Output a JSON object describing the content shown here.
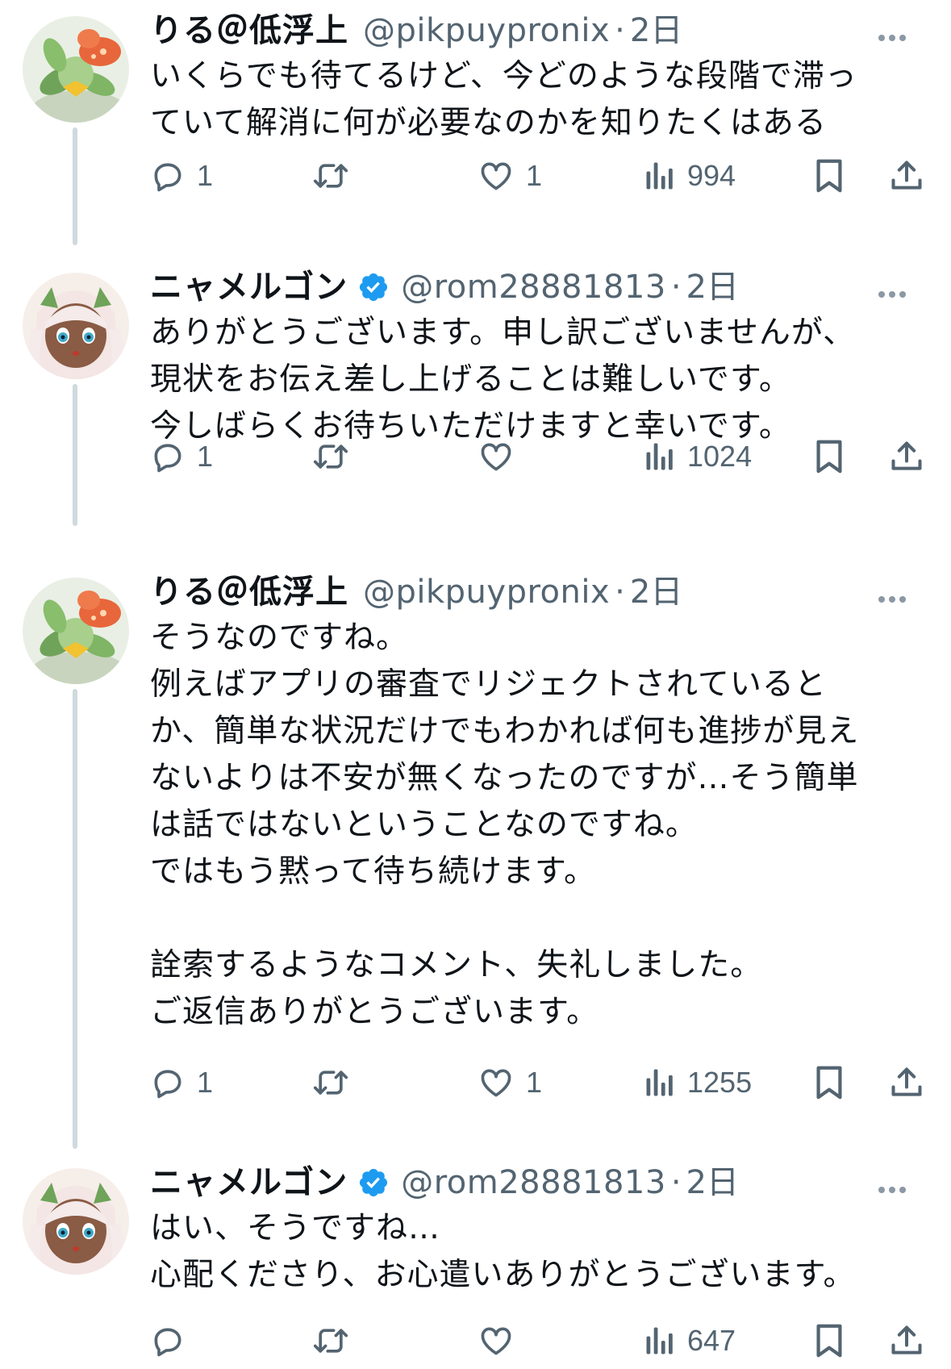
{
  "tweets": [
    {
      "display_name": "りる＠低浮上",
      "verified": false,
      "handle": "@pikpuypronix",
      "separator": "·",
      "time": "2日",
      "text": "いくらでも待てるけど、今どのような段階で滞っ\nていて解消に何が必要なのかを知りたくはある",
      "replies": "1",
      "retweets": "",
      "likes": "1",
      "views": "994"
    },
    {
      "display_name": "ニャメルゴン",
      "verified": true,
      "handle": "@rom28881813",
      "separator": "·",
      "time": "2日",
      "text": "ありがとうございます。申し訳ございませんが、\n現状をお伝え差し上げることは難しいです。\n今しばらくお待ちいただけますと幸いです。",
      "replies": "1",
      "retweets": "",
      "likes": "",
      "views": "1024"
    },
    {
      "display_name": "りる＠低浮上",
      "verified": false,
      "handle": "@pikpuypronix",
      "separator": "·",
      "time": "2日",
      "text": "そうなのですね。\n例えばアプリの審査でリジェクトされていると\nか、簡単な状況だけでもわかれば何も進捗が見え\nないよりは不安が無くなったのですが…そう簡単\nは話ではないということなのですね。\nではもう黙って待ち続けます。\n\n詮索するようなコメント、失礼しました。\nご返信ありがとうございます。",
      "replies": "1",
      "retweets": "",
      "likes": "1",
      "views": "1255"
    },
    {
      "display_name": "ニャメルゴン",
      "verified": true,
      "handle": "@rom28881813",
      "separator": "·",
      "time": "2日",
      "text": "はい、そうですね…\n心配くださり、お心遣いありがとうございます。",
      "replies": "",
      "retweets": "",
      "likes": "",
      "views": "647"
    }
  ],
  "icons": {
    "reply": "reply-icon",
    "retweet": "retweet-icon",
    "like": "heart-icon",
    "views": "views-icon",
    "bookmark": "bookmark-icon",
    "share": "share-icon",
    "more": "more-icon",
    "verified": "verified-icon"
  },
  "colors": {
    "text": "#0f1419",
    "secondary": "#536471",
    "verified": "#1d9bf0",
    "thread_line": "#cfd9de"
  }
}
